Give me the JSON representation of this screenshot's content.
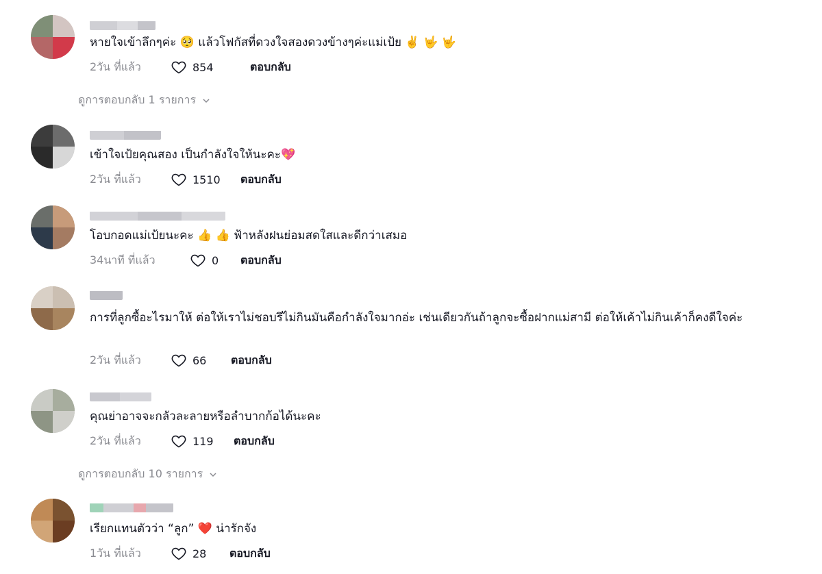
{
  "comments": [
    {
      "text": "หายใจเข้าลึกๆค่ะ 🥺 แล้วโฟกัสที่ดวงใจสองดวงข้างๆค่ะแม่เป้ย ✌️ 🤟 🤟",
      "time": "2วัน ที่แล้ว",
      "likes": "854",
      "reply_label": "ตอบกลับ",
      "view_replies": "ดูการตอบกลับ 1 รายการ"
    },
    {
      "text": "เข้าใจเป้ยคุณสอง เป็นกำลังใจให้นะคะ💖",
      "time": "2วัน ที่แล้ว",
      "likes": "1510",
      "reply_label": "ตอบกลับ"
    },
    {
      "text": "โอบกอดแม่เป้ยนะคะ 👍 👍 ฟ้าหลังฝนย่อมสดใสและดีกว่าเสมอ",
      "time": "34นาที ที่แล้ว",
      "likes": "0",
      "reply_label": "ตอบกลับ"
    },
    {
      "text": "การที่ลูกซื้อะไรมาให้ ต่อให้เราไม่ชอบรึไม่กินมันคือกำลังใจมากอ่ะ เช่นเดียวกันถ้าลูกจะซื้อฝากแม่สามี ต่อให้เค้าไม่กินเค้าก็คงดีใจค่ะ",
      "time": "2วัน ที่แล้ว",
      "likes": "66",
      "reply_label": "ตอบกลับ"
    },
    {
      "text": "คุณย่าอาจจะกลัวละลายหรือลำบากก้อได้นะคะ",
      "time": "2วัน ที่แล้ว",
      "likes": "119",
      "reply_label": "ตอบกลับ",
      "view_replies": "ดูการตอบกลับ 10 รายการ"
    },
    {
      "text": "เรียกแทนตัวว่า “ลูก” ❤️ น่ารักจัง",
      "time": "1วัน ที่แล้ว",
      "likes": "28",
      "reply_label": "ตอบกลับ"
    }
  ],
  "icons": {
    "like": "heart-outline-icon",
    "expand": "chevron-down-icon"
  },
  "colors": {
    "text": "#161823",
    "muted": "#8a8b91"
  }
}
